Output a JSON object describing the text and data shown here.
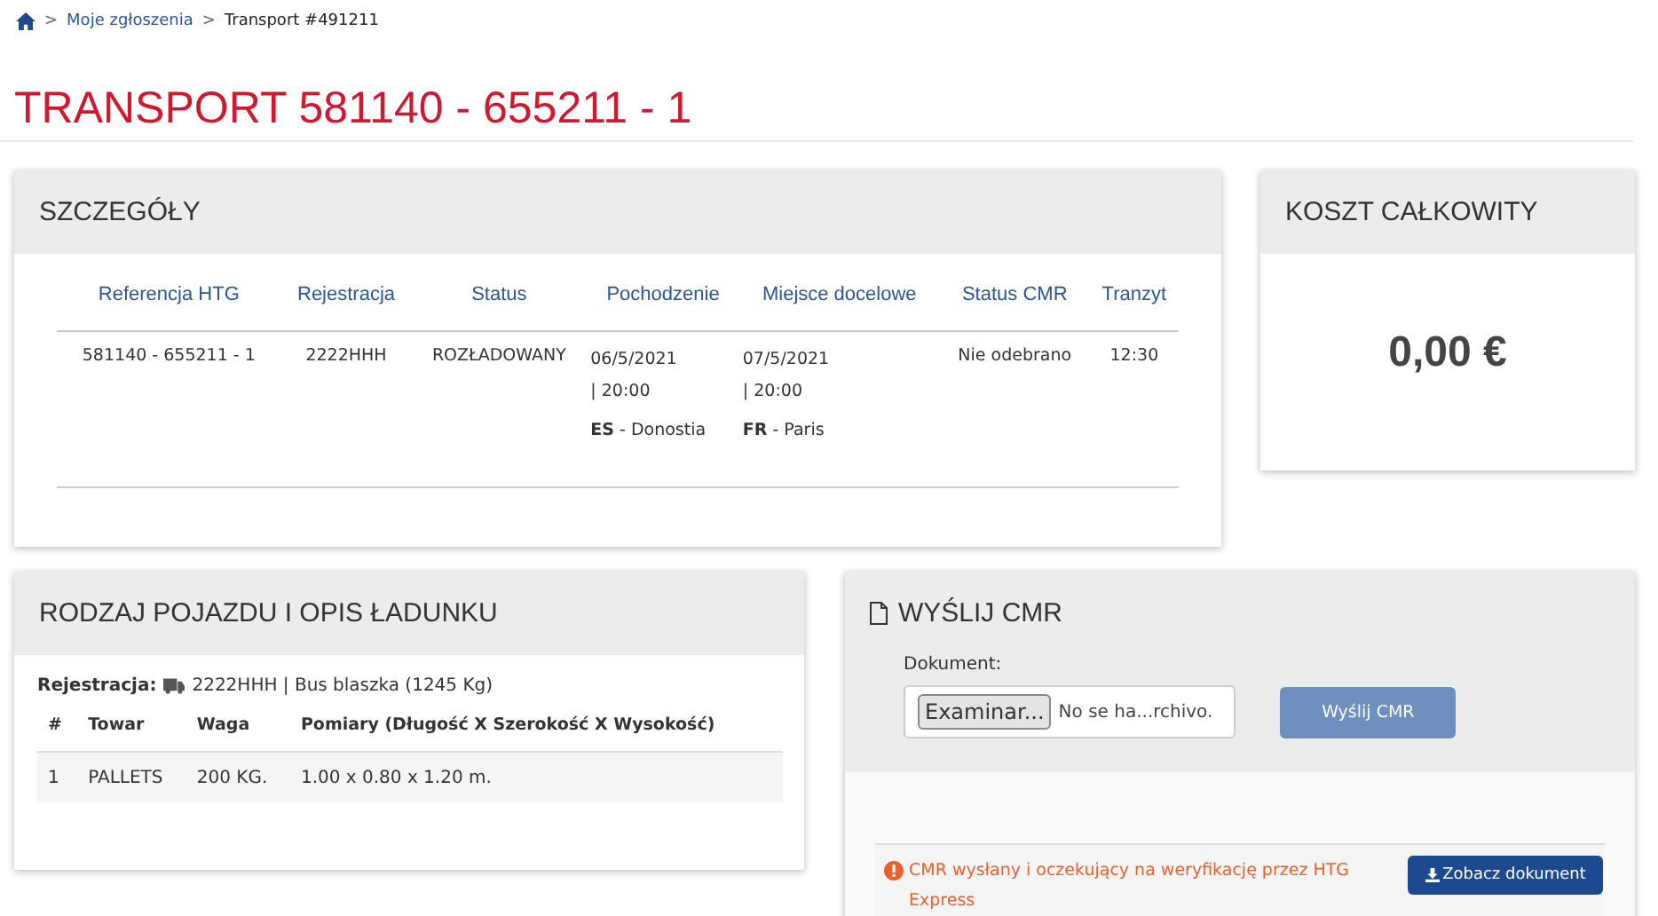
{
  "breadcrumb": [
    {
      "separator": ">",
      "label": "Moje zgłoszenia",
      "link": true
    },
    {
      "separator": ">",
      "label": "Transport #491211",
      "link": false
    }
  ],
  "title": "TRANSPORT 581140 - 655211 - 1",
  "details": {
    "title": "SZCZEGÓŁY",
    "columns": [
      "Referencja HTG",
      "Rejestracja",
      "Status",
      "Pochodzenie",
      "Miejsce docelowe",
      "Status CMR",
      "Tranzyt"
    ],
    "row": {
      "reference": "581140 - 655211 - 1",
      "registration": "2222HHH",
      "status": "ROZŁADOWANY",
      "origin": {
        "date": "06/5/2021",
        "time": "| 20:00",
        "location": "**ES** - Donostia"
      },
      "destination": {
        "date": "07/5/2021",
        "time": "| 20:00",
        "location": "**FR** - Paris"
      },
      "cmr_status": "Nie odebrano",
      "transit": "12:30"
    }
  },
  "cost": {
    "title": "KOSZT CAŁKOWITY",
    "value": "0,00 €"
  },
  "vehicle": {
    "title": "RODZAJ POJAZDU I OPIS ŁADUNKU",
    "registration_label": "Rejestracja:",
    "registration": "2222HHH | Bus blaszka (1245 Kg)",
    "columns": [
      "#",
      "Towar",
      "Waga",
      "Pomiary (Długość X Szerokość X Wysokość)"
    ],
    "rows": [
      {
        "no": "1",
        "goods": "PALLETS",
        "weight": "200 KG.",
        "dimensions": "1.00 x 0.80 x 1.20 m."
      }
    ]
  },
  "cmr": {
    "title": "WYŚLIJ CMR",
    "document_label": "Dokument:",
    "browse_button": "Examinar...",
    "file_text": "No se ha...rchivo.",
    "send_button": {
      "label": "Wyślij CMR",
      "disabled": true
    },
    "message": "CMR wysłany i oczekujący na weryfikację przez HTG Express",
    "view_button": "Zobacz dokument"
  }
}
